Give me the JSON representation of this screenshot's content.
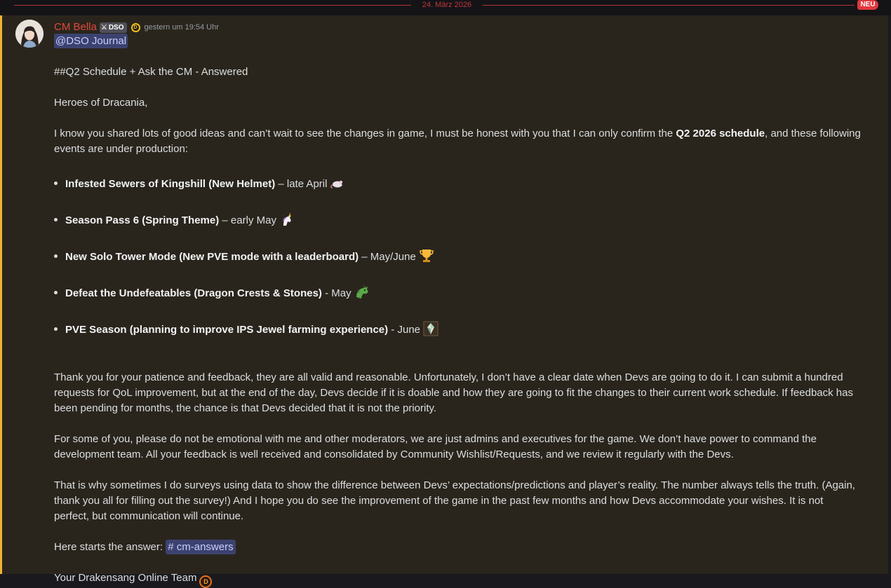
{
  "divider": {
    "date": "24. März 2026",
    "badge": "NEU"
  },
  "author": {
    "name": "CM Bella",
    "tag": "DSO",
    "timestamp": "gestern um 19:54 Uhr"
  },
  "mention": "@DSO Journal",
  "heading": "##Q2 Schedule + Ask the CM - Answered",
  "greeting": "Heroes of Dracania,",
  "intro": {
    "before": "I know you shared lots of good ideas and can’t wait to see the changes in game, I must be honest with you that I can only confirm the ",
    "bold": "Q2 2026 schedule",
    "after": ", and these following events are under production:"
  },
  "events": [
    {
      "title": "Infested Sewers of Kingshill (New Helmet)",
      "when": " – late April",
      "emoji": "rat-emoji"
    },
    {
      "title": "Season Pass 6 (Spring Theme)",
      "when": " – early May",
      "emoji": "unicorn-emoji"
    },
    {
      "title": "New Solo Tower Mode (New PVE mode with a leaderboard)",
      "when": " – May/June",
      "emoji": "trophy-emoji"
    },
    {
      "title": "Defeat the Undefeatables (Dragon Crests & Stones)",
      "when": " - May",
      "emoji": "dragon-emoji"
    },
    {
      "title": "PVE Season (planning to improve IPS Jewel farming experience)",
      "when": " - June",
      "emoji": "jewel-emoji"
    }
  ],
  "paragraphs": [
    "Thank you for your patience and feedback, they are all valid and reasonable. Unfortunately, I don’t have a clear date when Devs are going to do it. I can submit a hundred requests for QoL improvement, but at the end of the day, Devs decide if it is doable and how they are going to fit the changes to their current work schedule. If feedback has been pending for months, the chance is that Devs decided that it is not the priority.",
    "For some of you, please do not be emotional with me and other moderators, we are just admins and executives for the game. We don’t have power to command the development team. All your feedback is well received and consolidated by Community Wishlist/Requests, and we review it regularly with the Devs.",
    "That is why sometimes I do surveys using data to show the difference between Devs’ expectations/predictions and player’s reality. The number always tells the truth. (Again, thank you all for filling out the survey!) And I hope you do see the improvement of the game in the past few months and how Devs accommodate your wishes. It is not perfect, but communication will continue."
  ],
  "answer_line": {
    "text": "Here starts the answer: ",
    "channel": "cm-answers"
  },
  "signature": "Your Drakensang Online Team",
  "colors": {
    "username": "#e0473e",
    "divider": "#b3343a",
    "mention_bg": "#3c4270",
    "highlight_stripe": "#f0b232",
    "message_bg": "#2a251c"
  }
}
